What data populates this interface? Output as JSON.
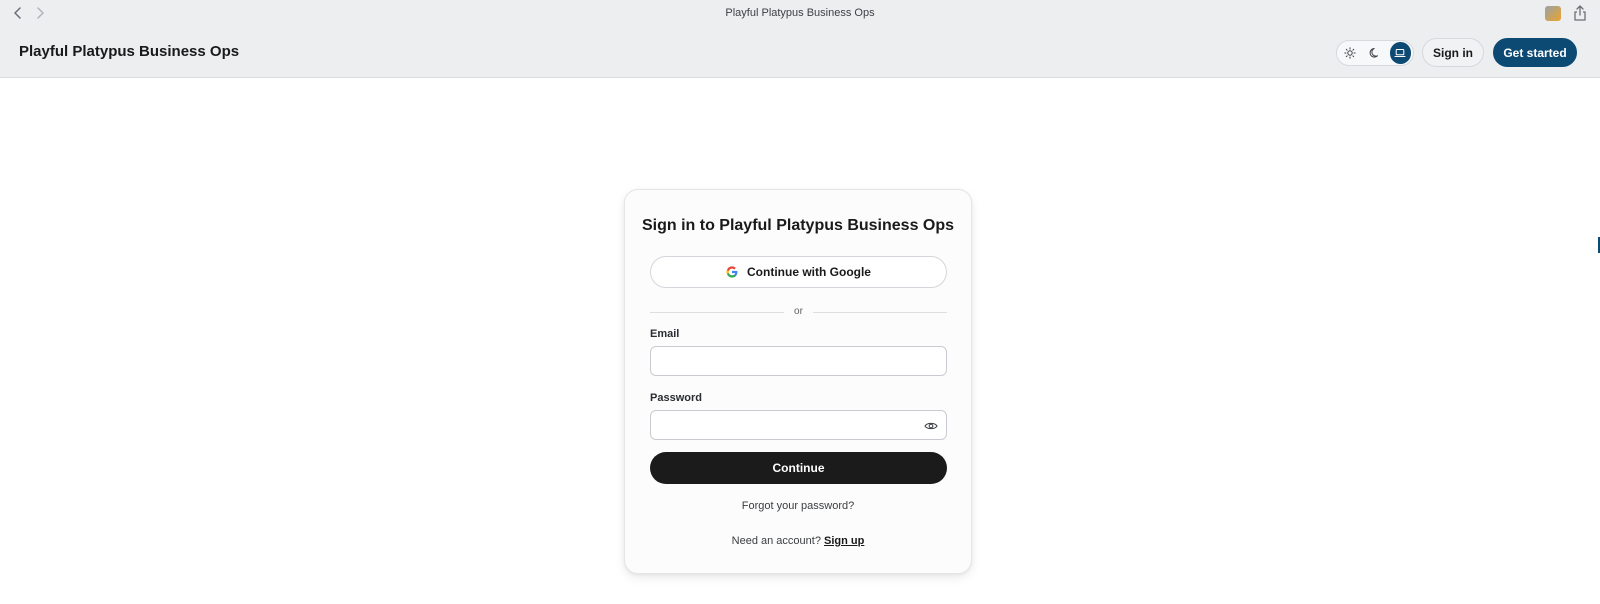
{
  "browser": {
    "window_title": "Playful Platypus Business Ops",
    "back_icon": "chevron-left-icon",
    "forward_icon": "chevron-right-icon",
    "extension_icon": "extension-icon",
    "share_icon": "share-icon"
  },
  "header": {
    "brand": "Playful Platypus Business Ops",
    "theme_options": [
      {
        "name": "light",
        "icon": "sun-icon",
        "active": false
      },
      {
        "name": "dark",
        "icon": "moon-icon",
        "active": false
      },
      {
        "name": "system",
        "icon": "laptop-icon",
        "active": true
      }
    ],
    "sign_in_label": "Sign in",
    "get_started_label": "Get started"
  },
  "auth": {
    "title": "Sign in to Playful Platypus Business Ops",
    "google_label": "Continue with Google",
    "divider_text": "or",
    "email_label": "Email",
    "email_value": "",
    "password_label": "Password",
    "password_value": "",
    "continue_label": "Continue",
    "forgot_label": "Forgot your password?",
    "signup_prompt": "Need an account?",
    "signup_link": "Sign up"
  },
  "colors": {
    "accent": "#0d4a73",
    "primary_button": "#1b1b1b",
    "chrome_bg": "#eceef0"
  }
}
